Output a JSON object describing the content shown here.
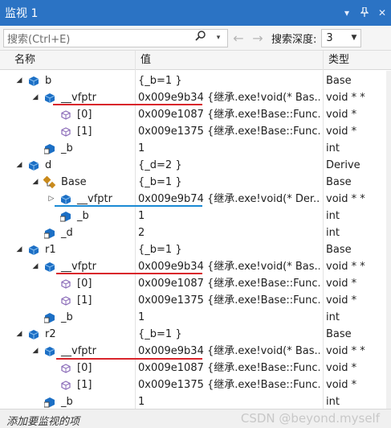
{
  "window": {
    "title": "监视 1",
    "buttons": [
      "▾",
      "📌",
      "✕"
    ]
  },
  "toolbar": {
    "search_placeholder": "搜索(Ctrl+E)",
    "search_icon": "search-icon",
    "back_icon": "←",
    "forward_icon": "→",
    "depth_label": "搜索深度:",
    "depth_value": "3"
  },
  "columns": {
    "name": "名称",
    "value": "值",
    "type": "类型"
  },
  "rows": [
    {
      "name": "b",
      "value": "{_b=1 }",
      "type": "Base"
    },
    {
      "name": "__vfptr",
      "value": "0x009e9b34 {继承.exe!void(* Bas...",
      "type": "void * *"
    },
    {
      "name": "[0]",
      "value": "0x009e1087 {继承.exe!Base::Func...",
      "type": "void *"
    },
    {
      "name": "[1]",
      "value": "0x009e1375 {继承.exe!Base::Func...",
      "type": "void *"
    },
    {
      "name": "_b",
      "value": "1",
      "type": "int"
    },
    {
      "name": "d",
      "value": "{_d=2 }",
      "type": "Derive"
    },
    {
      "name": "Base",
      "value": "{_b=1 }",
      "type": "Base"
    },
    {
      "name": "__vfptr",
      "value": "0x009e9b74 {继承.exe!void(* Der...",
      "type": "void * *"
    },
    {
      "name": "_b",
      "value": "1",
      "type": "int"
    },
    {
      "name": "_d",
      "value": "2",
      "type": "int"
    },
    {
      "name": "r1",
      "value": "{_b=1 }",
      "type": "Base"
    },
    {
      "name": "__vfptr",
      "value": "0x009e9b34 {继承.exe!void(* Bas...",
      "type": "void * *"
    },
    {
      "name": "[0]",
      "value": "0x009e1087 {继承.exe!Base::Func...",
      "type": "void *"
    },
    {
      "name": "[1]",
      "value": "0x009e1375 {继承.exe!Base::Func...",
      "type": "void *"
    },
    {
      "name": "_b",
      "value": "1",
      "type": "int"
    },
    {
      "name": "r2",
      "value": "{_b=1 }",
      "type": "Base"
    },
    {
      "name": "__vfptr",
      "value": "0x009e9b34 {继承.exe!void(* Bas...",
      "type": "void * *"
    },
    {
      "name": "[0]",
      "value": "0x009e1087 {继承.exe!Base::Func...",
      "type": "void *"
    },
    {
      "name": "[1]",
      "value": "0x009e1375 {继承.exe!Base::Func...",
      "type": "void *"
    },
    {
      "name": "_b",
      "value": "1",
      "type": "int"
    }
  ],
  "footer": {
    "add_watch": "添加要监视的项",
    "watermark": "CSDN @beyond.myself"
  },
  "colors": {
    "title_bar": "#2b73c4",
    "annotation_red": "#d9252b",
    "annotation_blue": "#1a8ad4"
  }
}
